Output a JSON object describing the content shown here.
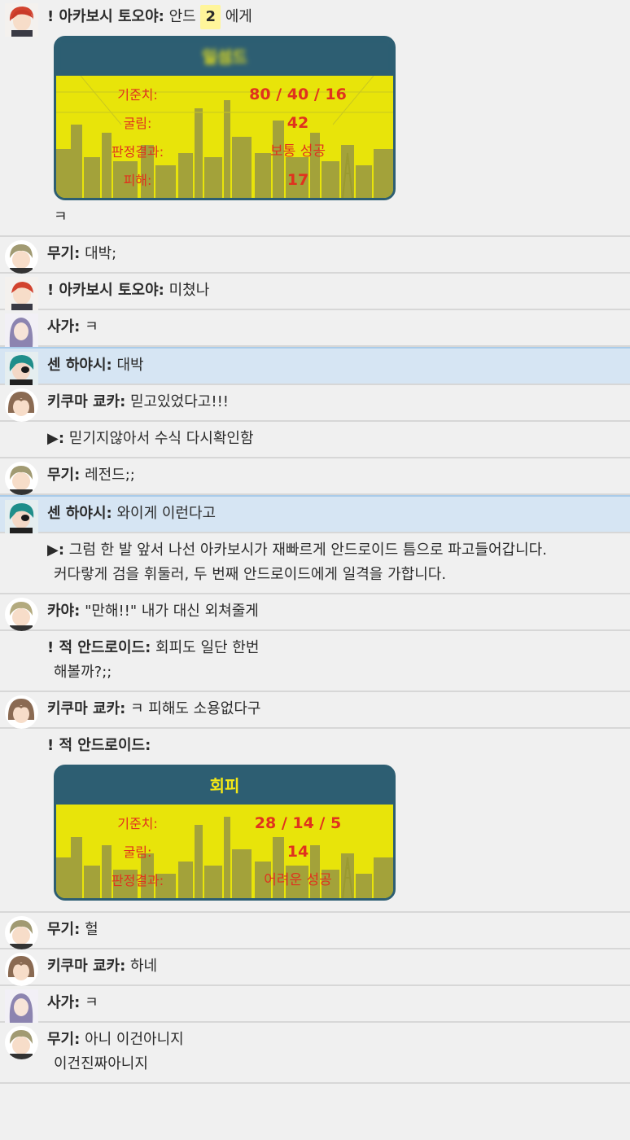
{
  "messages": [
    {
      "name": "! 아카보시 토오야:",
      "pre": "안드",
      "badge": "2",
      "post": "에게",
      "extra": "ㅋ"
    },
    {
      "name": "무기:",
      "text": "대박;"
    },
    {
      "name": "! 아카보시 토오야:",
      "text": "미쳤나"
    },
    {
      "name": "사가:",
      "text": "ㅋ"
    },
    {
      "name": "센 하야시:",
      "text": "대박"
    },
    {
      "name": "키쿠마 쿄카:",
      "text": "믿고있었다고!!!"
    },
    {
      "name": "▶:",
      "text": "믿기지않아서 수식 다시확인함"
    },
    {
      "name": "무기:",
      "text": "레전드;;"
    },
    {
      "name": "센 하야시:",
      "text": "와이게 이런다고"
    },
    {
      "name": "▶:",
      "text": "그럼 한 발 앞서 나선 아카보시가 재빠르게 안드로이드 틈으로 파고들어갑니다.",
      "cont": "커다랗게 검을 휘둘러, 두 번째 안드로이드에게 일격을 가합니다."
    },
    {
      "name": "카야:",
      "text": "\"만해!!\" 내가 대신 외쳐줄게"
    },
    {
      "name": "! 적 안드로이드:",
      "text": "회피도 일단 한번",
      "cont": "해볼까?;;"
    },
    {
      "name": "키쿠마 쿄카:",
      "text": "ㅋ 피해도 소용없다구"
    },
    {
      "name": "! 적 안드로이드:",
      "text": ""
    },
    {
      "name": "무기:",
      "text": "헐"
    },
    {
      "name": "키쿠마 쿄카:",
      "text": "하네"
    },
    {
      "name": "사가:",
      "text": "ㅋ"
    },
    {
      "name": "무기:",
      "text": "아니 이건아니지",
      "cont": "이건진짜아니지"
    }
  ],
  "card1": {
    "title": "일섬드",
    "rows": [
      {
        "label": "기준치:",
        "value": "80 / 40 / 16"
      },
      {
        "label": "굴림:",
        "value": "42"
      },
      {
        "label": "판정결과:",
        "value": "보통 성공"
      },
      {
        "label": "피해:",
        "value": "17"
      }
    ]
  },
  "card2": {
    "title": "회피",
    "rows": [
      {
        "label": "기준치:",
        "value": "28 / 14 / 5"
      },
      {
        "label": "굴림:",
        "value": "14"
      },
      {
        "label": "판정결과:",
        "value": "어려운 성공"
      }
    ]
  },
  "colors": {
    "card_header": "#2d5e72",
    "card_body": "#e8e40a",
    "card_text": "#e0321e",
    "highlight_row": "#d6e5f3",
    "badge": "#fff59a"
  },
  "avatars": [
    "red-hair-avatar",
    "green-hair-avatar",
    "purple-hair-avatar",
    "teal-hair-eyepatch-avatar",
    "brown-hair-avatar"
  ]
}
